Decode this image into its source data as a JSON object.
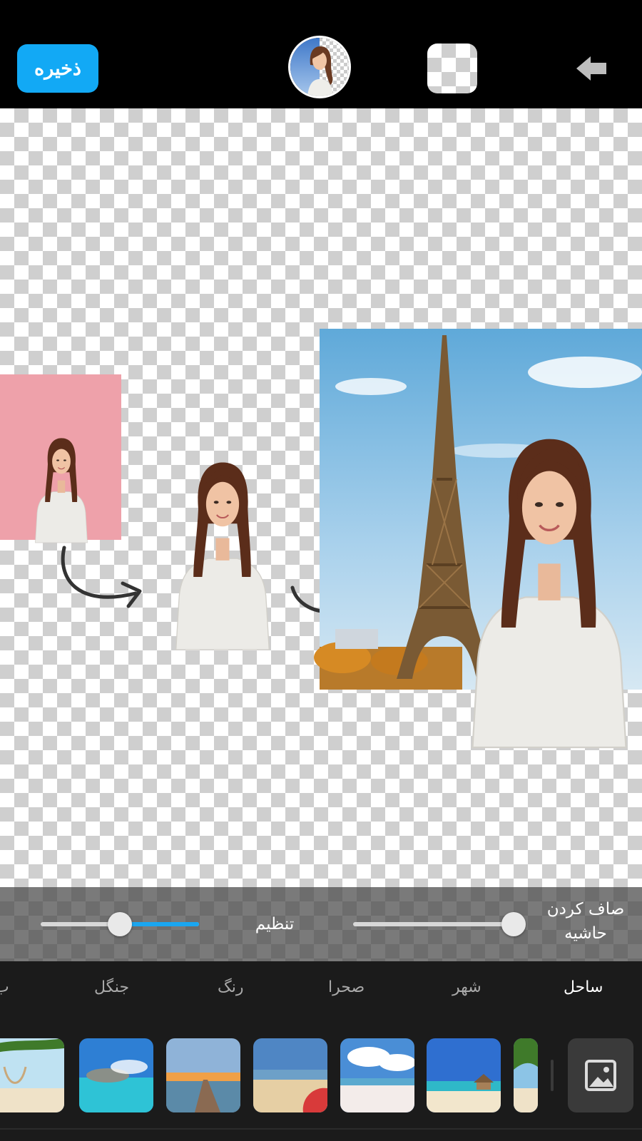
{
  "toolbar": {
    "save_label": "ذخیره",
    "back_icon": "arrow-left-icon"
  },
  "adjust": {
    "edge_smooth_label_line1": "صاف کردن",
    "edge_smooth_label_line2": "حاشیه",
    "adjust_label": "تنظیم",
    "edge_smooth_value": 1.0,
    "adjust_value": 0.5,
    "accent_color": "#1aa6f0"
  },
  "categories": [
    "ساحل",
    "شهر",
    "صحرا",
    "رنگ",
    "جنگل",
    "ب"
  ],
  "active_category": "ساحل",
  "thumbnails": [
    "beach-hammock",
    "tropical-lagoon",
    "pier-sunset",
    "beach-umbrella",
    "white-sand-clouds",
    "beach-huts",
    "palm-beach"
  ],
  "colors": {
    "save_button": "#12a9f5",
    "top_bar": "#000000",
    "panel": "#1b1b1b"
  }
}
